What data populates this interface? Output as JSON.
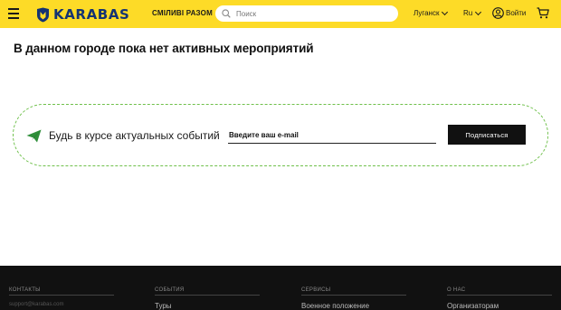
{
  "header": {
    "logo_text": "KARABAS",
    "slogan": "СМІЛИВІ РАЗОМ",
    "search_placeholder": "Поиск",
    "city": "Луганск",
    "language": "Ru",
    "login_label": "Войти",
    "colors": {
      "background": "#fddb27",
      "logo": "#143373"
    }
  },
  "main": {
    "title": "В данном городе пока нет активных мероприятий"
  },
  "subscribe": {
    "text": "Будь в курсе актуальных событий",
    "email_placeholder": "Введите ваш e-mail",
    "button_label": "Подписаться",
    "border_color": "#6fc04b"
  },
  "footer": {
    "columns": [
      {
        "heading": "КОНТАКТЫ",
        "item": "support@karabas.com"
      },
      {
        "heading": "СОБЫТИЯ",
        "item": "Туры"
      },
      {
        "heading": "СЕРВИСЫ",
        "item": "Военное положение"
      },
      {
        "heading": "О НАС",
        "item": "Организаторам"
      }
    ]
  }
}
